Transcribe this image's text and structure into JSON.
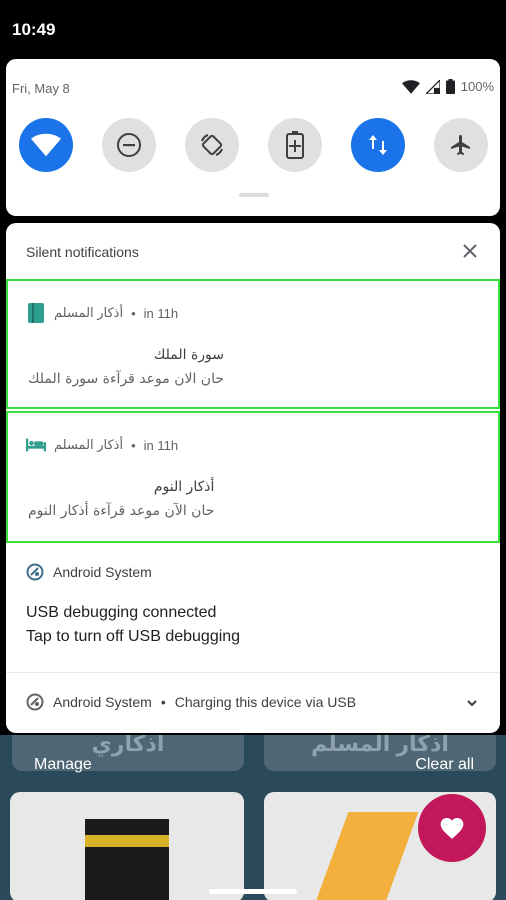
{
  "status_bar": {
    "time": "10:49"
  },
  "quick_settings": {
    "date": "Fri, May 8",
    "battery_percent": "100%",
    "tiles": [
      {
        "name": "wifi",
        "active": true
      },
      {
        "name": "do-not-disturb",
        "active": false
      },
      {
        "name": "auto-rotate",
        "active": false
      },
      {
        "name": "battery-saver",
        "active": false
      },
      {
        "name": "mobile-data",
        "active": true
      },
      {
        "name": "airplane-mode",
        "active": false
      }
    ]
  },
  "notifications": {
    "silent_header": "Silent notifications",
    "items": [
      {
        "app": "أذكار المسلم",
        "time": "in 11h",
        "title": "سورة الملك",
        "text": "حان الان موعد قرآءة سورة الملك",
        "icon": "book-icon"
      },
      {
        "app": "أذكار المسلم",
        "time": "in 11h",
        "title": "أذكار النوم",
        "text": "حان الآن موعد قرآءة أذكار النوم",
        "icon": "bed-icon"
      }
    ],
    "system": {
      "app": "Android System",
      "title": "USB debugging connected",
      "text": "Tap to turn off USB debugging"
    },
    "system_collapsed": {
      "app": "Android System",
      "text": "Charging this device via USB"
    },
    "separator": "•"
  },
  "footer": {
    "manage": "Manage",
    "clear_all": "Clear all"
  },
  "background_app": {
    "card1_title": "أذكاري",
    "card2_title": "أذكار المسلم"
  },
  "colors": {
    "accent": "#1a73e8",
    "highlight_border": "#37e23a",
    "app_icon": "#2e9e8f"
  }
}
